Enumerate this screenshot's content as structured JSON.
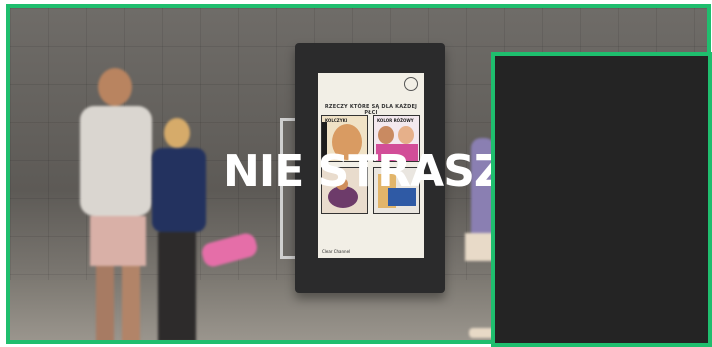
{
  "headline": "NIE STRASZ",
  "advertisement": {
    "caption": "RZECZY KTÓRE SĄ DLA KAŻDEJ PŁCI",
    "panel_top_left": "KOLCZYKI",
    "panel_top_right": "KOLOR RÓŻOWY",
    "footer": "Clear Channel"
  },
  "colors": {
    "frame_accent": "#1fbe6e",
    "dark_panel": "#242424"
  }
}
